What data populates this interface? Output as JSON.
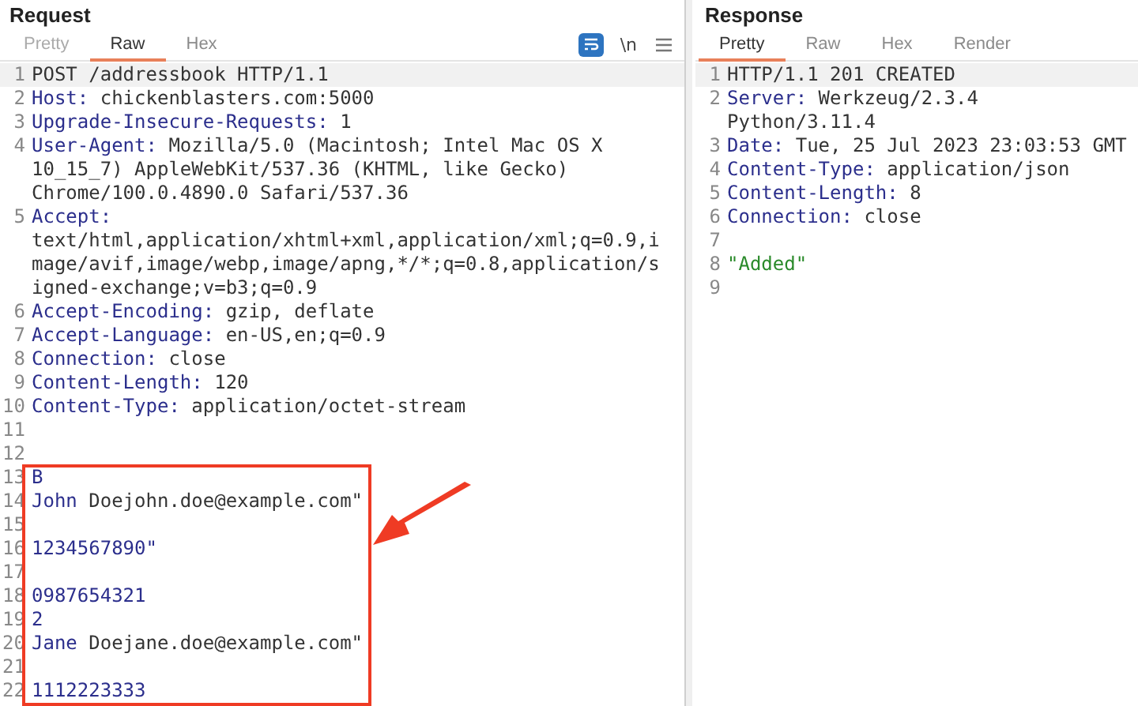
{
  "request": {
    "title": "Request",
    "tabs": [
      {
        "label": "Pretty",
        "selected": false
      },
      {
        "label": "Raw",
        "selected": true
      },
      {
        "label": "Hex",
        "selected": false
      }
    ],
    "tools": {
      "wrap_on": true,
      "newline_label": "\\n"
    },
    "lines": [
      {
        "number": "1",
        "current": true,
        "segments": [
          {
            "text": "POST /addressbook HTTP/1.1",
            "kind": "text"
          }
        ]
      },
      {
        "number": "2",
        "current": false,
        "segments": [
          {
            "text": "Host:",
            "kind": "name"
          },
          {
            "text": " chickenblasters.com:5000",
            "kind": "text"
          }
        ]
      },
      {
        "number": "3",
        "current": false,
        "segments": [
          {
            "text": "Upgrade-Insecure-Requests:",
            "kind": "name"
          },
          {
            "text": " 1",
            "kind": "text"
          }
        ]
      },
      {
        "number": "4",
        "current": false,
        "segments": [
          {
            "text": "User-Agent:",
            "kind": "name"
          },
          {
            "text": " Mozilla/5.0 (Macintosh; Intel Mac OS X 10_15_7) AppleWebKit/537.36 (KHTML, like Gecko) Chrome/100.0.4890.0 Safari/537.36",
            "kind": "text"
          }
        ]
      },
      {
        "number": "5",
        "current": false,
        "segments": [
          {
            "text": "Accept:",
            "kind": "name"
          },
          {
            "text": " text/html,application/xhtml+xml,application/xml;q=0.9,image/avif,image/webp,image/apng,*/*;q=0.8,application/signed-exchange;v=b3;q=0.9",
            "kind": "text"
          }
        ]
      },
      {
        "number": "6",
        "current": false,
        "segments": [
          {
            "text": "Accept-Encoding:",
            "kind": "name"
          },
          {
            "text": " gzip, deflate",
            "kind": "text"
          }
        ]
      },
      {
        "number": "7",
        "current": false,
        "segments": [
          {
            "text": "Accept-Language:",
            "kind": "name"
          },
          {
            "text": " en-US,en;q=0.9",
            "kind": "text"
          }
        ]
      },
      {
        "number": "8",
        "current": false,
        "segments": [
          {
            "text": "Connection:",
            "kind": "name"
          },
          {
            "text": " close",
            "kind": "text"
          }
        ]
      },
      {
        "number": "9",
        "current": false,
        "segments": [
          {
            "text": "Content-Length:",
            "kind": "name"
          },
          {
            "text": " 120",
            "kind": "text"
          }
        ]
      },
      {
        "number": "10",
        "current": false,
        "segments": [
          {
            "text": "Content-Type:",
            "kind": "name"
          },
          {
            "text": " application/octet-stream",
            "kind": "text"
          }
        ]
      },
      {
        "number": "11",
        "current": false
      },
      {
        "number": "12",
        "current": false
      },
      {
        "number": "13",
        "current": false,
        "segments": [
          {
            "text": "B",
            "kind": "name"
          }
        ]
      },
      {
        "number": "14",
        "current": false,
        "segments": [
          {
            "text": "John",
            "kind": "name"
          },
          {
            "text": " Doejohn.doe@example.com\"",
            "kind": "text"
          }
        ]
      },
      {
        "number": "15",
        "current": false
      },
      {
        "number": "16",
        "current": false,
        "segments": [
          {
            "text": "1234567890\"",
            "kind": "name"
          }
        ]
      },
      {
        "number": "17",
        "current": false
      },
      {
        "number": "18",
        "current": false,
        "segments": [
          {
            "text": "0987654321",
            "kind": "name"
          }
        ]
      },
      {
        "number": "19",
        "current": false,
        "segments": [
          {
            "text": "2",
            "kind": "name"
          }
        ]
      },
      {
        "number": "20",
        "current": false,
        "segments": [
          {
            "text": "Jane",
            "kind": "name"
          },
          {
            "text": " Doejane.doe@example.com\"",
            "kind": "text"
          }
        ]
      },
      {
        "number": "21",
        "current": false
      },
      {
        "number": "22",
        "current": false,
        "segments": [
          {
            "text": "1112223333",
            "kind": "name"
          }
        ]
      }
    ]
  },
  "response": {
    "title": "Response",
    "tabs": [
      {
        "label": "Pretty",
        "selected": true
      },
      {
        "label": "Raw",
        "selected": false
      },
      {
        "label": "Hex",
        "selected": false
      },
      {
        "label": "Render",
        "selected": false
      }
    ],
    "lines": [
      {
        "number": "1",
        "current": true,
        "segments": [
          {
            "text": "HTTP/1.1 201 CREATED",
            "kind": "text"
          }
        ]
      },
      {
        "number": "2",
        "current": false,
        "segments": [
          {
            "text": "Server:",
            "kind": "name"
          },
          {
            "text": " Werkzeug/2.3.4 Python/3.11.4",
            "kind": "text"
          }
        ]
      },
      {
        "number": "3",
        "current": false,
        "segments": [
          {
            "text": "Date:",
            "kind": "name"
          },
          {
            "text": " Tue, 25 Jul 2023 23:03:53 GMT",
            "kind": "text"
          }
        ]
      },
      {
        "number": "4",
        "current": false,
        "segments": [
          {
            "text": "Content-Type:",
            "kind": "name"
          },
          {
            "text": " application/json",
            "kind": "text"
          }
        ]
      },
      {
        "number": "5",
        "current": false,
        "segments": [
          {
            "text": "Content-Length:",
            "kind": "name"
          },
          {
            "text": " 8",
            "kind": "text"
          }
        ]
      },
      {
        "number": "6",
        "current": false,
        "segments": [
          {
            "text": "Connection:",
            "kind": "name"
          },
          {
            "text": " close",
            "kind": "text"
          }
        ]
      },
      {
        "number": "7",
        "current": false
      },
      {
        "number": "8",
        "current": false,
        "segments": [
          {
            "text": "\"Added\"",
            "kind": "string"
          }
        ]
      },
      {
        "number": "9",
        "current": false
      }
    ]
  },
  "annotation": {
    "kind": "highlight-box-with-arrow"
  }
}
